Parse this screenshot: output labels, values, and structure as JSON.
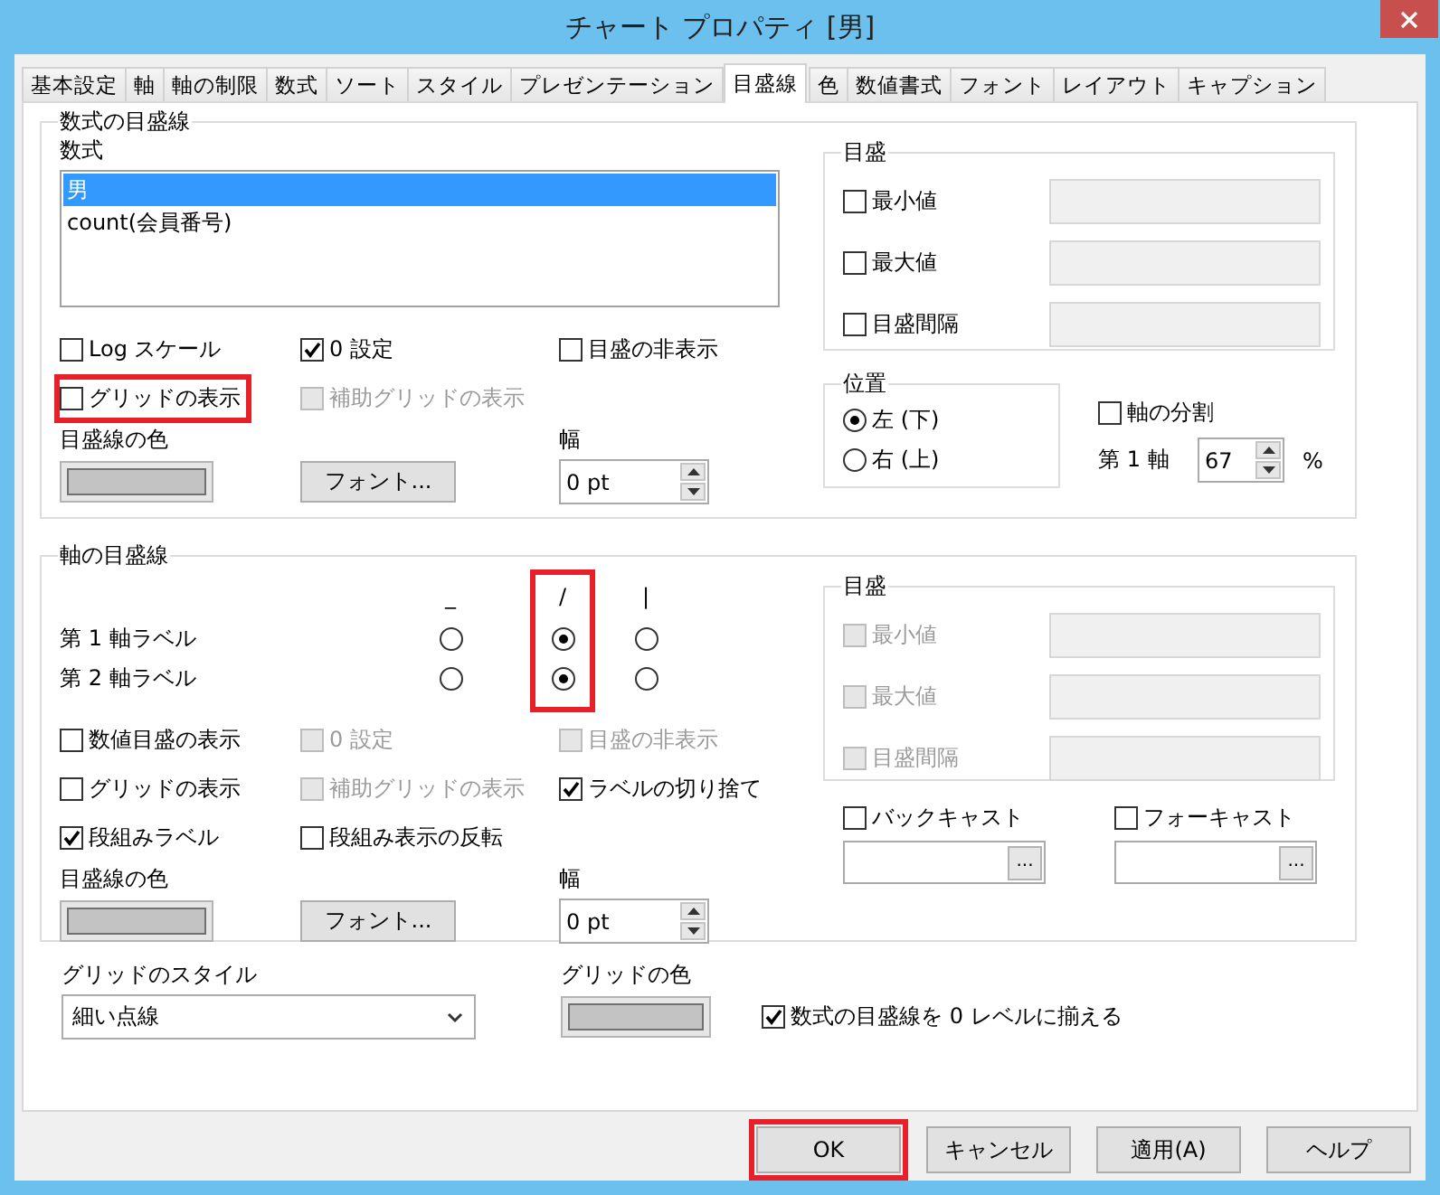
{
  "window": {
    "title": "チャート プロパティ [男]"
  },
  "tabs": [
    {
      "label": "基本設定",
      "selected": false
    },
    {
      "label": "軸",
      "selected": false
    },
    {
      "label": "軸の制限",
      "selected": false
    },
    {
      "label": "数式",
      "selected": false
    },
    {
      "label": "ソート",
      "selected": false
    },
    {
      "label": "スタイル",
      "selected": false
    },
    {
      "label": "プレゼンテーション",
      "selected": false
    },
    {
      "label": "目盛線",
      "selected": true
    },
    {
      "label": "色",
      "selected": false
    },
    {
      "label": "数値書式",
      "selected": false
    },
    {
      "label": "フォント",
      "selected": false
    },
    {
      "label": "レイアウト",
      "selected": false
    },
    {
      "label": "キャプション",
      "selected": false
    }
  ],
  "formula_gridlines": {
    "title": "数式の目盛線",
    "formula_label": "数式",
    "formulas": [
      {
        "text": "男",
        "selected": true
      },
      {
        "text": "count(会員番号)",
        "selected": false
      }
    ],
    "options": [
      {
        "label": "Log スケール",
        "checked": false,
        "disabled": false,
        "highlighted": false
      },
      {
        "label": "0 設定",
        "checked": true,
        "disabled": false,
        "highlighted": false
      },
      {
        "label": "目盛の非表示",
        "checked": false,
        "disabled": false,
        "highlighted": false
      },
      {
        "label": "グリッドの表示",
        "checked": false,
        "disabled": false,
        "highlighted": true
      },
      {
        "label": "補助グリッドの表示",
        "checked": false,
        "disabled": true,
        "highlighted": false
      }
    ],
    "line_color_label": "目盛線の色",
    "font_button": "フォント...",
    "width_label": "幅",
    "width_value": "0 pt",
    "scale": {
      "title": "目盛",
      "rows": [
        {
          "label": "最小値",
          "checked": false,
          "disabled": false
        },
        {
          "label": "最大値",
          "checked": false,
          "disabled": false
        },
        {
          "label": "目盛間隔",
          "checked": false,
          "disabled": false
        }
      ]
    },
    "position": {
      "title": "位置",
      "options": [
        {
          "label": "左 (下)",
          "selected": true
        },
        {
          "label": "右 (上)",
          "selected": false
        }
      ]
    },
    "axis_split": {
      "label": "軸の分割",
      "checked": false
    },
    "first_axis": {
      "label": "第 1 軸",
      "value": "67",
      "unit": "%"
    }
  },
  "axis_gridlines": {
    "title": "軸の目盛線",
    "orientations": [
      {
        "symbol": "_",
        "highlighted": false
      },
      {
        "symbol": "/",
        "highlighted": true
      },
      {
        "symbol": "|",
        "highlighted": false
      }
    ],
    "label_rows": [
      {
        "label": "第 1 軸ラベル",
        "choices": [
          {
            "selected": false
          },
          {
            "selected": true
          },
          {
            "selected": false
          }
        ]
      },
      {
        "label": "第 2 軸ラベル",
        "choices": [
          {
            "selected": false
          },
          {
            "selected": true
          },
          {
            "selected": false
          }
        ]
      }
    ],
    "options": [
      {
        "label": "数値目盛の表示",
        "checked": false,
        "disabled": false,
        "highlighted": false
      },
      {
        "label": "0 設定",
        "checked": false,
        "disabled": true,
        "highlighted": false
      },
      {
        "label": "目盛の非表示",
        "checked": false,
        "disabled": true,
        "highlighted": false
      },
      {
        "label": "グリッドの表示",
        "checked": false,
        "disabled": false,
        "highlighted": false
      },
      {
        "label": "補助グリッドの表示",
        "checked": false,
        "disabled": true,
        "highlighted": false
      },
      {
        "label": "ラベルの切り捨て",
        "checked": true,
        "disabled": false,
        "highlighted": false
      },
      {
        "label": "段組みラベル",
        "checked": true,
        "disabled": false,
        "highlighted": false
      },
      {
        "label": "段組み表示の反転",
        "checked": false,
        "disabled": false,
        "highlighted": false
      }
    ],
    "line_color_label": "目盛線の色",
    "font_button": "フォント...",
    "width_label": "幅",
    "width_value": "0 pt",
    "scale": {
      "title": "目盛",
      "rows": [
        {
          "label": "最小値",
          "checked": false,
          "disabled": true
        },
        {
          "label": "最大値",
          "checked": false,
          "disabled": true
        },
        {
          "label": "目盛間隔",
          "checked": false,
          "disabled": true
        }
      ]
    },
    "forecasts": [
      {
        "label": "バックキャスト",
        "checked": false,
        "button": "..."
      },
      {
        "label": "フォーキャスト",
        "checked": false,
        "button": "..."
      }
    ]
  },
  "grid_style": {
    "label": "グリッドのスタイル",
    "value": "細い点線"
  },
  "grid_color": {
    "label": "グリッドの色"
  },
  "align_zero": {
    "label": "数式の目盛線を 0 レベルに揃える",
    "checked": true
  },
  "buttons": [
    {
      "label": "OK",
      "highlighted": true
    },
    {
      "label": "キャンセル",
      "highlighted": false
    },
    {
      "label": "適用(A)",
      "highlighted": false
    },
    {
      "label": "ヘルプ",
      "highlighted": false
    }
  ]
}
